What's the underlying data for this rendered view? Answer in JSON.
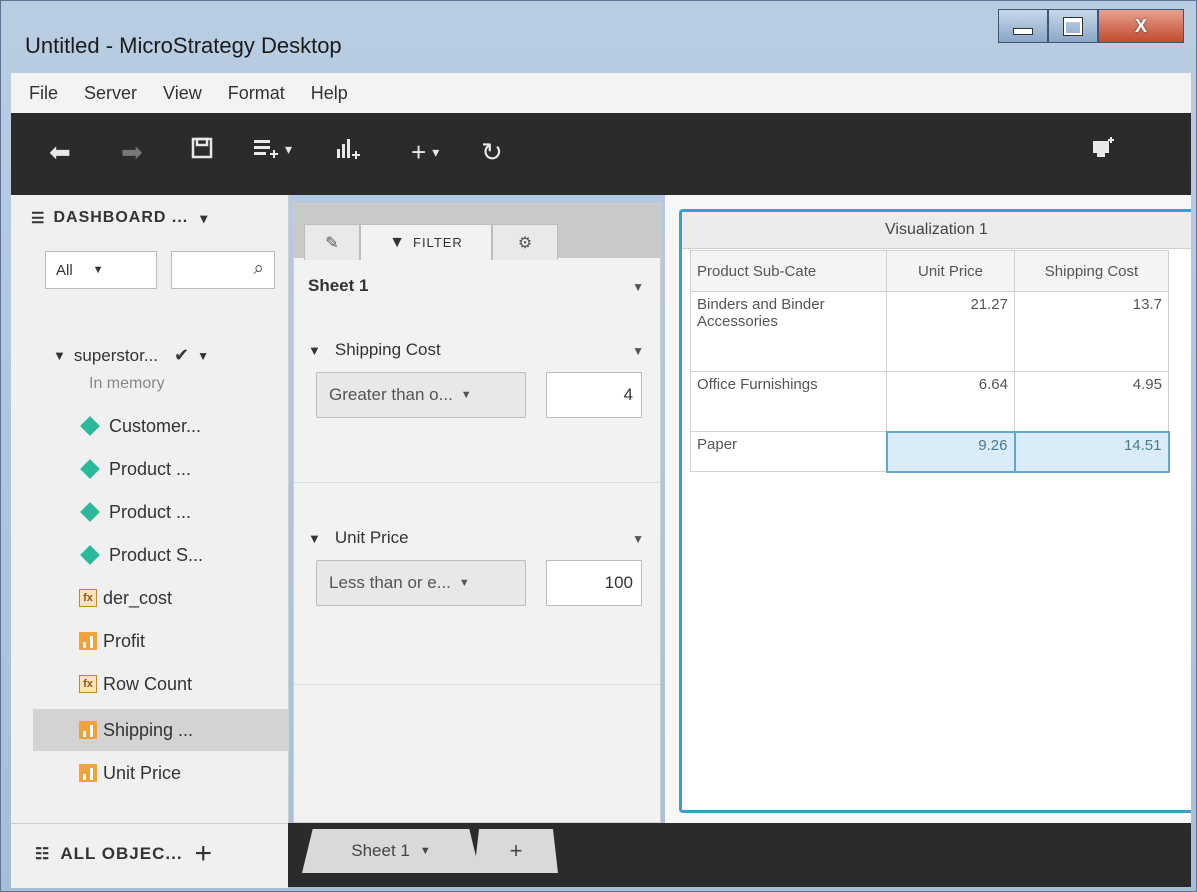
{
  "window": {
    "title": "Untitled - MicroStrategy Desktop",
    "minimize": "–",
    "maximize": "□",
    "close": "X"
  },
  "menu": [
    "File",
    "Server",
    "View",
    "Format",
    "Help"
  ],
  "toolbar": {
    "icons": [
      "undo-icon",
      "redo-icon",
      "save-icon",
      "add-data-icon",
      "add-visualization-icon",
      "insert-icon",
      "refresh-icon",
      "present-icon"
    ]
  },
  "datasets": {
    "header": "DASHBOARD ...",
    "filter_select": "All",
    "search_placeholder": "",
    "dataset_name": "superstor...",
    "dataset_status": "In memory",
    "objects": [
      {
        "label": "Customer...",
        "type": "attribute"
      },
      {
        "label": "Product ...",
        "type": "attribute"
      },
      {
        "label": "Product ...",
        "type": "attribute"
      },
      {
        "label": "Product S...",
        "type": "attribute"
      },
      {
        "label": "der_cost",
        "type": "derived-metric"
      },
      {
        "label": "Profit",
        "type": "metric"
      },
      {
        "label": "Row Count",
        "type": "derived-metric"
      },
      {
        "label": "Shipping ...",
        "type": "metric",
        "selected": true
      },
      {
        "label": "Unit Price",
        "type": "metric"
      }
    ],
    "all_objects": "ALL OBJEC..."
  },
  "filter_panel": {
    "tabs": [
      {
        "label": "",
        "icon": "edit-icon"
      },
      {
        "label": "FILTER",
        "icon": "filter-icon"
      },
      {
        "label": "",
        "icon": "gear-icon"
      }
    ],
    "sheet": "Sheet 1",
    "filters": [
      {
        "name": "Shipping Cost",
        "operator": "Greater than o...",
        "value": "4"
      },
      {
        "name": "Unit Price",
        "operator": "Less than or e...",
        "value": "100"
      }
    ]
  },
  "visualization": {
    "title": "Visualization 1",
    "columns": [
      "Product Sub-Cate",
      "Unit Price",
      "Shipping Cost"
    ],
    "rows": [
      {
        "category": "Binders and Binder Accessories",
        "unit_price": "21.27",
        "shipping_cost": "13.7"
      },
      {
        "category": "Office Furnishings",
        "unit_price": "6.64",
        "shipping_cost": "4.95"
      },
      {
        "category": "Paper",
        "unit_price": "9.26",
        "shipping_cost": "14.51",
        "highlighted": true
      }
    ]
  },
  "sheets": {
    "tabs": [
      "Sheet 1"
    ],
    "add_label": "+"
  }
}
